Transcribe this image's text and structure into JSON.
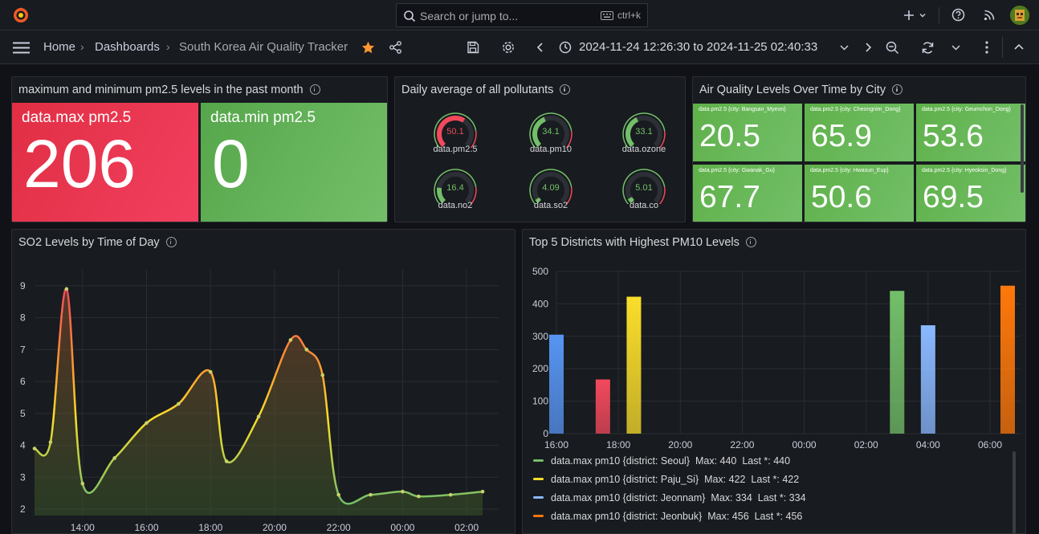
{
  "search": {
    "placeholder": "Search or jump to...",
    "shortcut": "ctrl+k"
  },
  "breadcrumb": {
    "home": "Home",
    "dashboards": "Dashboards",
    "current": "South Korea Air Quality Tracker"
  },
  "time_range": "2024-11-24 12:26:30 to 2024-11-25 02:40:33",
  "panels": {
    "pm25": {
      "title": "maximum and minimum pm2.5 levels in the past month",
      "max_label": "data.max pm2.5",
      "max_value": "206",
      "min_label": "data.min pm2.5",
      "min_value": "0"
    },
    "daily": {
      "title": "Daily average of all pollutants",
      "gauges": [
        {
          "label": "data.pm2.5",
          "value": "50.1",
          "color": "#f2495c",
          "fraction": 0.62
        },
        {
          "label": "data.pm10",
          "value": "34.1",
          "color": "#73bf69",
          "fraction": 0.42
        },
        {
          "label": "data.ozone",
          "value": "33.1",
          "color": "#73bf69",
          "fraction": 0.41
        },
        {
          "label": "data.no2",
          "value": "16.4",
          "color": "#73bf69",
          "fraction": 0.2
        },
        {
          "label": "data.so2",
          "value": "4.09",
          "color": "#73bf69",
          "fraction": 0.05
        },
        {
          "label": "data.co",
          "value": "5.01",
          "color": "#73bf69",
          "fraction": 0.06
        }
      ]
    },
    "cities": {
      "title": "Air Quality Levels Over Time by City",
      "items": [
        {
          "label": "data.pm2.5 {city: Bangsan_Myeon}",
          "value": "20.5"
        },
        {
          "label": "data.pm2.5 {city: Cheongnim_Dong}",
          "value": "65.9"
        },
        {
          "label": "data.pm2.5 {city: Geumchon_Dong}",
          "value": "53.6"
        },
        {
          "label": "data.pm2.5 {city: Gwanak_Gu}",
          "value": "67.7"
        },
        {
          "label": "data.pm2.5 {city: Hwasun_Eup}",
          "value": "50.6"
        },
        {
          "label": "data.pm2.5 {city: Hyeoksin_Dong}",
          "value": "69.5"
        }
      ]
    },
    "so2": {
      "title": "SO2 Levels by Time of Day"
    },
    "pm10": {
      "title": "Top 5 Districts with Highest PM10 Levels",
      "legend": [
        {
          "text": "data.max pm10 {district: Seoul}  Max: 440  Last *: 440",
          "color": "#73bf69"
        },
        {
          "text": "data.max pm10 {district: Paju_Si}  Max: 422  Last *: 422",
          "color": "#fade2a"
        },
        {
          "text": "data.max pm10 {district: Jeonnam}  Max: 334  Last *: 334",
          "color": "#8ab8ff"
        },
        {
          "text": "data.max pm10 {district: Jeonbuk}  Max: 456  Last *: 456",
          "color": "#ff780a"
        }
      ]
    }
  },
  "chart_data": [
    {
      "type": "area",
      "title": "SO2 Levels by Time of Day",
      "x": [
        "12:30",
        "13:00",
        "13:30",
        "14:00",
        "15:00",
        "16:00",
        "17:00",
        "18:00",
        "18:30",
        "19:30",
        "20:30",
        "21:00",
        "21:30",
        "22:00",
        "23:00",
        "00:00",
        "00:30",
        "01:30",
        "02:30"
      ],
      "x_ticks": [
        "14:00",
        "16:00",
        "18:00",
        "20:00",
        "22:00",
        "00:00",
        "02:00"
      ],
      "series": [
        {
          "values": [
            3.9,
            4.1,
            8.9,
            2.8,
            3.6,
            4.7,
            5.3,
            6.3,
            3.5,
            4.9,
            7.3,
            7.0,
            6.2,
            2.45,
            2.45,
            2.55,
            2.4,
            2.45,
            2.55
          ]
        }
      ],
      "ylim": [
        1.8,
        9.5
      ],
      "y_ticks": [
        2,
        3,
        4,
        5,
        6,
        7,
        8,
        9
      ],
      "grid": true
    },
    {
      "type": "bar",
      "title": "Top 5 Districts with Highest PM10 Levels",
      "x_ticks": [
        "16:00",
        "18:00",
        "20:00",
        "22:00",
        "00:00",
        "02:00",
        "04:00",
        "06:00"
      ],
      "bars": [
        {
          "x": "16:00",
          "value": 305,
          "color": "#5794f2"
        },
        {
          "x": "17:30",
          "value": 167,
          "color": "#f2495c"
        },
        {
          "x": "18:30",
          "value": 422,
          "color": "#fade2a"
        },
        {
          "x": "03:00",
          "value": 440,
          "color": "#73bf69"
        },
        {
          "x": "04:00",
          "value": 334,
          "color": "#8ab8ff"
        },
        {
          "x": "06:00",
          "value": 456,
          "color": "#ff780a"
        }
      ],
      "ylim": [
        0,
        500
      ],
      "y_ticks": [
        0,
        100,
        200,
        300,
        400,
        500
      ],
      "grid": true
    }
  ]
}
